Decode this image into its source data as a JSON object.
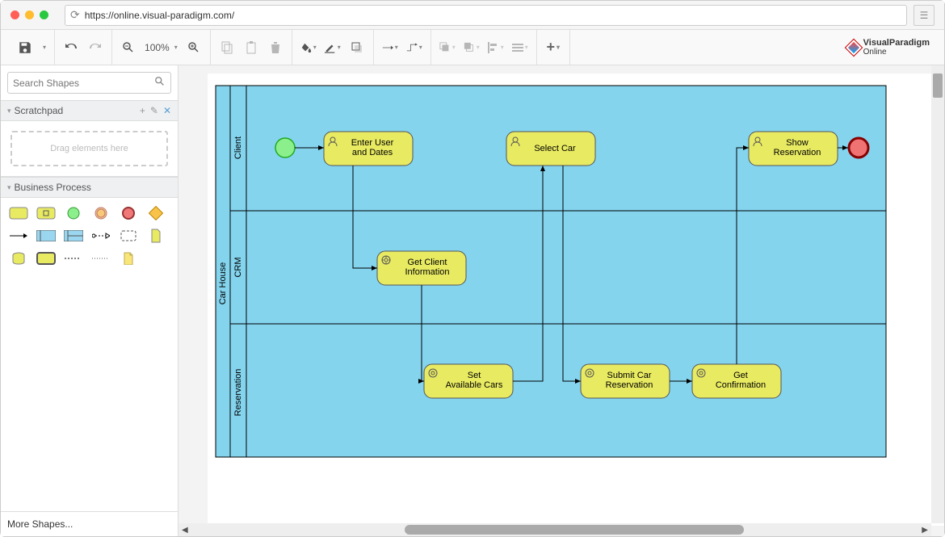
{
  "titlebar": {
    "url": "https://online.visual-paradigm.com/"
  },
  "toolbar": {
    "zoom_value": "100%"
  },
  "logo": {
    "line1": "VisualParadigm",
    "line2": "Online"
  },
  "sidebar": {
    "search_placeholder": "Search Shapes",
    "scratchpad_title": "Scratchpad",
    "drop_hint": "Drag elements here",
    "business_process_title": "Business Process",
    "more_shapes": "More Shapes..."
  },
  "diagram": {
    "pool": "Car House",
    "lanes": [
      "Client",
      "CRM",
      "Reservation"
    ],
    "activities": {
      "enter_user": "Enter User and Dates",
      "select_car": "Select Car",
      "show_reservation": "Show Reservation",
      "get_client": "Get Client Information",
      "set_cars": "Set Available Cars",
      "submit_reservation": "Submit Car Reservation",
      "get_confirmation": "Get Confirmation"
    }
  }
}
